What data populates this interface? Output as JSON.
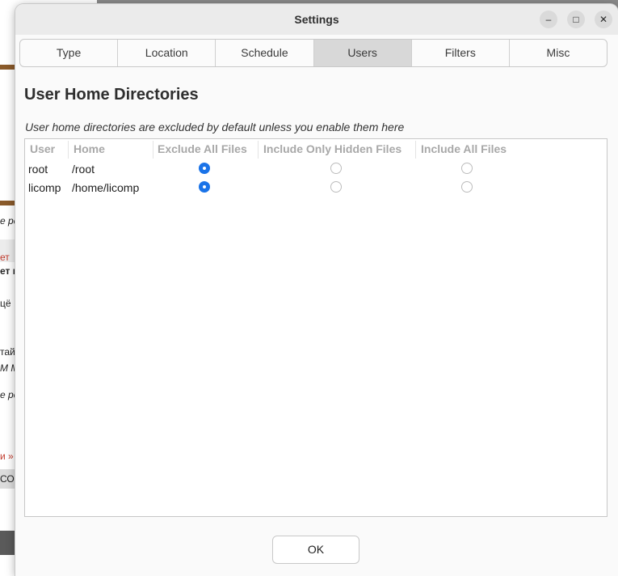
{
  "window": {
    "title": "Settings",
    "controls": {
      "minimize": "–",
      "maximize": "□",
      "close": "✕"
    }
  },
  "tabs": [
    {
      "label": "Type",
      "active": false
    },
    {
      "label": "Location",
      "active": false
    },
    {
      "label": "Schedule",
      "active": false
    },
    {
      "label": "Users",
      "active": true
    },
    {
      "label": "Filters",
      "active": false
    },
    {
      "label": "Misc",
      "active": false
    }
  ],
  "section": {
    "title": "User Home Directories",
    "hint": "User home directories are excluded by default unless you enable them here"
  },
  "table": {
    "columns": [
      "User",
      "Home",
      "Exclude All Files",
      "Include Only Hidden Files",
      "Include All Files"
    ],
    "rows": [
      {
        "user": "root",
        "home": "/root",
        "selected": "Exclude All Files"
      },
      {
        "user": "licomp",
        "home": "/home/licomp",
        "selected": "Exclude All Files"
      }
    ]
  },
  "footer": {
    "ok_label": "OK"
  },
  "background_fragments": [
    "е ре",
    "ет",
    "ет к",
    "цё",
    "тай",
    "М М",
    "е ре",
    "и »",
    "СО"
  ],
  "colors": {
    "accent": "#1a73e8",
    "active_tab": "#d8d8d8",
    "titlebar": "#ebebeb"
  }
}
